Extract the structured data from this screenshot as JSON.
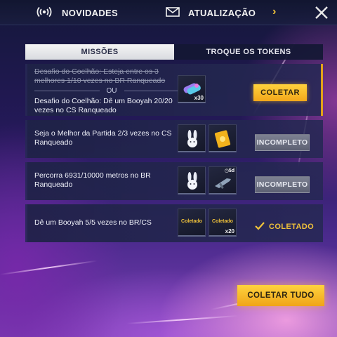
{
  "header": {
    "news_label": "NOVIDADES",
    "update_label": "ATUALIZAÇÃO"
  },
  "tabs": [
    {
      "label": "MISSÕES",
      "active": true
    },
    {
      "label": "TROQUE OS TOKENS",
      "active": false
    }
  ],
  "missions": [
    {
      "old_text": "Desafio do Coelhão: Esteja entre os 3 melhores 1/10 vezes no BR Ranqueado",
      "or_label": "OU",
      "text": "Desafio do Coelhão: Dê um Booyah 20/20 vezes no CS Ranqueado",
      "rewards": [
        {
          "icon": "crystal-token-icon",
          "count": "x30"
        }
      ],
      "action": {
        "type": "collect",
        "label": "COLETAR"
      }
    },
    {
      "text": "Seja o Melhor da Partida 2/3 vezes no CS Ranqueado",
      "rewards": [
        {
          "icon": "bunny-emote-icon",
          "count": ""
        },
        {
          "icon": "gold-voucher-icon",
          "count": ""
        }
      ],
      "action": {
        "type": "incomplete",
        "label": "INCOMPLETO"
      }
    },
    {
      "text": "Percorra 6931/10000 metros no BR Ranqueado",
      "rewards": [
        {
          "icon": "bunny-emote-icon",
          "count": ""
        },
        {
          "icon": "weapon-skin-icon",
          "count": "",
          "badge": "5d"
        }
      ],
      "action": {
        "type": "incomplete",
        "label": "INCOMPLETO"
      }
    },
    {
      "text": "Dê um Booyah 5/5 vezes no BR/CS",
      "rewards": [
        {
          "icon": "collected-reward-icon",
          "label": "Coletado",
          "count": ""
        },
        {
          "icon": "collected-reward-icon",
          "label": "Coletado",
          "count": "x20"
        }
      ],
      "action": {
        "type": "collected",
        "label": "COLETADO"
      }
    }
  ],
  "footer": {
    "collect_all_label": "COLETAR TUDO"
  },
  "colors": {
    "accent_gold": "#f0c23a",
    "button_gold": "#f2a71b",
    "incomplete_gray": "#6d7182"
  }
}
